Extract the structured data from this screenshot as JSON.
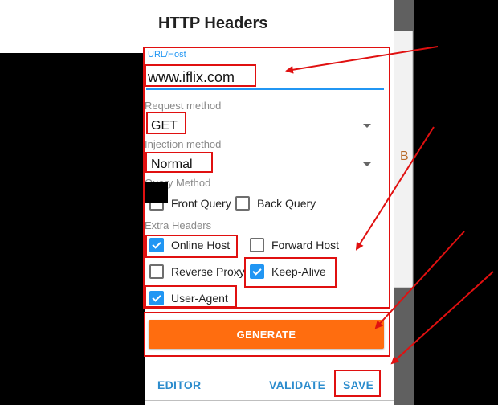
{
  "dialog": {
    "title": "HTTP Headers",
    "url_label": "URL/Host",
    "url_value": "www.iflix.com",
    "request_method_label": "Request method",
    "request_method_value": "GET",
    "injection_method_label": "Injection method",
    "injection_method_value": "Normal",
    "query_method_label": "Query Method",
    "query_options": [
      {
        "label": "Front Query",
        "checked": false
      },
      {
        "label": "Back Query",
        "checked": false
      }
    ],
    "extra_headers_label": "Extra Headers",
    "extra_headers": [
      {
        "label": "Online Host",
        "checked": true
      },
      {
        "label": "Forward Host",
        "checked": false
      },
      {
        "label": "Reverse Proxy",
        "checked": false
      },
      {
        "label": "Keep-Alive",
        "checked": true
      },
      {
        "label": "User-Agent",
        "checked": true
      }
    ],
    "generate_label": "GENERATE",
    "actions": {
      "editor": "EDITOR",
      "validate": "VALIDATE",
      "save": "SAVE"
    }
  },
  "background": {
    "partial_text": "B"
  },
  "colors": {
    "accent": "#2196f3",
    "generate": "#ff6d0f",
    "annotation": "#e01010",
    "action_text": "#2b8ccd"
  }
}
